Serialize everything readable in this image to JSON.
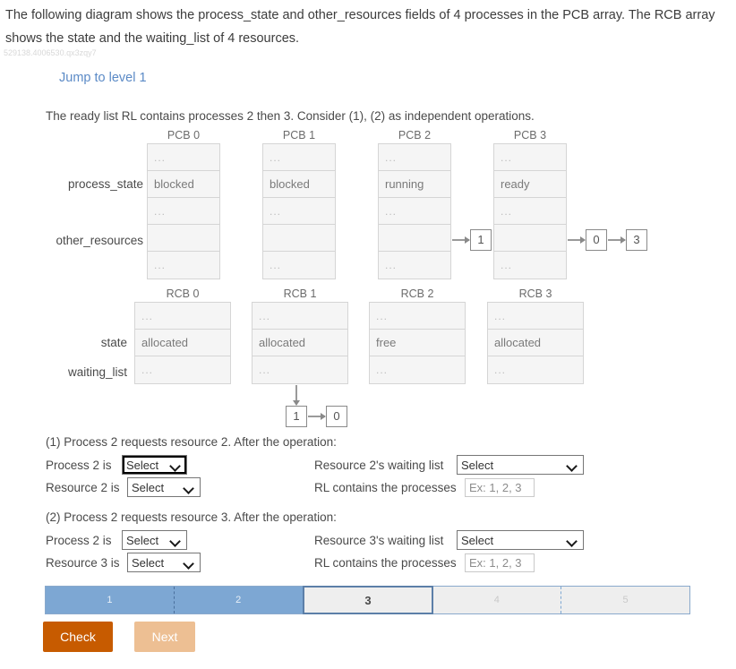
{
  "intro": "The following diagram shows the process_state and other_resources fields of 4 processes in the PCB array. The RCB array shows the state and the waiting_list of 4 resources.",
  "question_id": "529138.4006530.qx3zqy7",
  "jump_link": "Jump to level 1",
  "prompt": "The ready list RL contains processes 2 then 3. Consider (1), (2) as independent operations.",
  "dots": "...",
  "pcb": {
    "row_labels": {
      "process_state": "process_state",
      "other_resources": "other_resources"
    },
    "columns": [
      {
        "title": "PCB 0",
        "state": "blocked",
        "nodes": []
      },
      {
        "title": "PCB 1",
        "state": "blocked",
        "nodes": []
      },
      {
        "title": "PCB 2",
        "state": "running",
        "nodes": [
          "1"
        ]
      },
      {
        "title": "PCB 3",
        "state": "ready",
        "nodes": [
          "0",
          "3"
        ]
      }
    ]
  },
  "rcb": {
    "row_labels": {
      "state": "state",
      "waiting_list": "waiting_list"
    },
    "columns": [
      {
        "title": "RCB 0",
        "state": "allocated",
        "nodes": []
      },
      {
        "title": "RCB 1",
        "state": "allocated",
        "nodes": [
          "1",
          "0"
        ]
      },
      {
        "title": "RCB 2",
        "state": "free",
        "nodes": []
      },
      {
        "title": "RCB 3",
        "state": "allocated",
        "nodes": []
      }
    ]
  },
  "questions": [
    {
      "heading": "(1) Process 2 requests resource 2. After the operation:",
      "process_label": "Process 2 is",
      "process_value": "Select",
      "resource_label": "Resource 2 is",
      "resource_value": "Select",
      "waiting_label": "Resource 2's waiting list",
      "waiting_value": "Select",
      "rl_label": "RL contains the processes",
      "rl_value": "",
      "rl_placeholder": "Ex: 1, 2, 3"
    },
    {
      "heading": "(2) Process 2 requests resource 3. After the operation:",
      "process_label": "Process 2 is",
      "process_value": "Select",
      "resource_label": "Resource 3 is",
      "resource_value": "Select",
      "waiting_label": "Resource 3's waiting list",
      "waiting_value": "Select",
      "rl_label": "RL contains the processes",
      "rl_value": "",
      "rl_placeholder": "Ex: 1, 2, 3"
    }
  ],
  "progress": {
    "steps": [
      {
        "label": "1",
        "state": "done"
      },
      {
        "label": "2",
        "state": "done"
      },
      {
        "label": "3",
        "state": "current"
      },
      {
        "label": "4",
        "state": "todo"
      },
      {
        "label": "5",
        "state": "todo"
      }
    ]
  },
  "buttons": {
    "check": "Check",
    "next": "Next"
  },
  "colors": {
    "link": "#5b8ac6",
    "check_button": "#c75b00",
    "next_button": "#edbf93",
    "progress_done": "#7da7d3",
    "progress_border": "#5c7fa8"
  }
}
